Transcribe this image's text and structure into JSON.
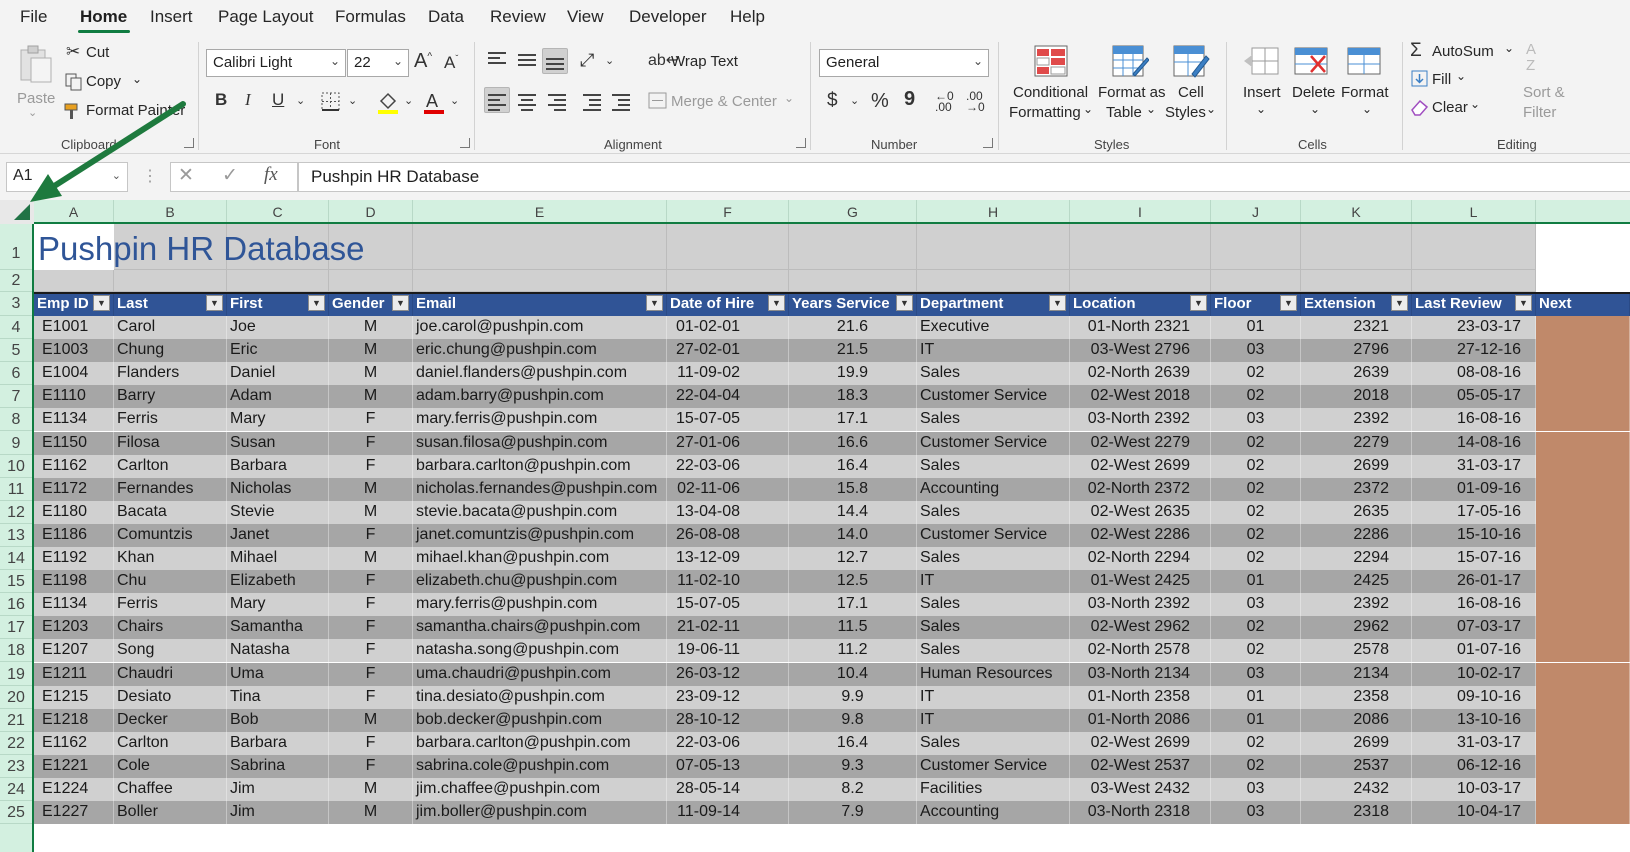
{
  "menu": {
    "items": [
      "File",
      "Home",
      "Insert",
      "Page Layout",
      "Formulas",
      "Data",
      "Review",
      "View",
      "Developer",
      "Help"
    ],
    "active": "Home",
    "accent": "#107c41"
  },
  "ribbon": {
    "clipboard": {
      "paste": "Paste",
      "cut": "Cut",
      "copy": "Copy",
      "format_painter": "Format Painter",
      "group": "Clipboard"
    },
    "font": {
      "family": "Calibri Light",
      "size": "22",
      "bold": "B",
      "italic": "I",
      "underline": "U",
      "grow": "A",
      "shrink": "A",
      "fill_color": "#ffff00",
      "font_color": "#e00000",
      "group": "Font"
    },
    "alignment": {
      "wrap_text": "Wrap Text",
      "merge_center": "Merge & Center",
      "group": "Alignment"
    },
    "number": {
      "format": "General",
      "currency": "$",
      "percent": "%",
      "comma": "9",
      "group": "Number"
    },
    "styles": {
      "conditional_1": "Conditional",
      "conditional_2": "Formatting",
      "format_table_1": "Format as",
      "format_table_2": "Table",
      "cell_styles_1": "Cell",
      "cell_styles_2": "Styles",
      "group": "Styles"
    },
    "cells": {
      "insert": "Insert",
      "delete": "Delete",
      "format": "Format",
      "group": "Cells"
    },
    "editing": {
      "autosum": "AutoSum",
      "fill": "Fill",
      "clear": "Clear",
      "sort_1": "Sort &",
      "sort_2": "Filter",
      "group": "Editing"
    }
  },
  "formula_bar": {
    "name_box": "A1",
    "fx": "fx",
    "content": "Pushpin HR Database"
  },
  "sheet": {
    "columns": [
      "A",
      "B",
      "C",
      "D",
      "E",
      "F",
      "G",
      "H",
      "I",
      "J",
      "K",
      "L"
    ],
    "rows": [
      "1",
      "2",
      "3",
      "4",
      "5",
      "6",
      "7",
      "8",
      "9",
      "10",
      "11",
      "12",
      "13",
      "14",
      "15",
      "16",
      "17",
      "18",
      "19",
      "20",
      "21",
      "22",
      "23",
      "24",
      "25"
    ],
    "title": "Pushpin HR Database",
    "headers": [
      "Emp ID",
      "Last",
      "First",
      "Gender",
      "Email",
      "Date of Hire",
      "Years Service",
      "Department",
      "Location",
      "Floor",
      "Extension",
      "Last Review",
      "Next"
    ],
    "header_color": "#305496",
    "band_dark": "#a6a6a6",
    "band_light": "#d0d0d0",
    "records": [
      [
        "E1001",
        "Carol",
        "Joe",
        "M",
        "joe.carol@pushpin.com",
        "01-02-01",
        "21.6",
        "Executive",
        "01-North 2321",
        "01",
        "2321",
        "23-03-17"
      ],
      [
        "E1003",
        "Chung",
        "Eric",
        "M",
        "eric.chung@pushpin.com",
        "27-02-01",
        "21.5",
        "IT",
        "03-West 2796",
        "03",
        "2796",
        "27-12-16"
      ],
      [
        "E1004",
        "Flanders",
        "Daniel",
        "M",
        "daniel.flanders@pushpin.com",
        "11-09-02",
        "19.9",
        "Sales",
        "02-North 2639",
        "02",
        "2639",
        "08-08-16"
      ],
      [
        "E1110",
        "Barry",
        "Adam",
        "M",
        "adam.barry@pushpin.com",
        "22-04-04",
        "18.3",
        "Customer Service",
        "02-West 2018",
        "02",
        "2018",
        "05-05-17"
      ],
      [
        "E1134",
        "Ferris",
        "Mary",
        "F",
        "mary.ferris@pushpin.com",
        "15-07-05",
        "17.1",
        "Sales",
        "03-North 2392",
        "03",
        "2392",
        "16-08-16"
      ],
      [
        "E1150",
        "Filosa",
        "Susan",
        "F",
        "susan.filosa@pushpin.com",
        "27-01-06",
        "16.6",
        "Customer Service",
        "02-West 2279",
        "02",
        "2279",
        "14-08-16"
      ],
      [
        "E1162",
        "Carlton",
        "Barbara",
        "F",
        "barbara.carlton@pushpin.com",
        "22-03-06",
        "16.4",
        "Sales",
        "02-West 2699",
        "02",
        "2699",
        "31-03-17"
      ],
      [
        "E1172",
        "Fernandes",
        "Nicholas",
        "M",
        "nicholas.fernandes@pushpin.com",
        "02-11-06",
        "15.8",
        "Accounting",
        "02-North 2372",
        "02",
        "2372",
        "01-09-16"
      ],
      [
        "E1180",
        "Bacata",
        "Stevie",
        "M",
        "stevie.bacata@pushpin.com",
        "13-04-08",
        "14.4",
        "Sales",
        "02-West 2635",
        "02",
        "2635",
        "17-05-16"
      ],
      [
        "E1186",
        "Comuntzis",
        "Janet",
        "F",
        "janet.comuntzis@pushpin.com",
        "26-08-08",
        "14.0",
        "Customer Service",
        "02-West 2286",
        "02",
        "2286",
        "15-10-16"
      ],
      [
        "E1192",
        "Khan",
        "Mihael",
        "M",
        "mihael.khan@pushpin.com",
        "13-12-09",
        "12.7",
        "Sales",
        "02-North 2294",
        "02",
        "2294",
        "15-07-16"
      ],
      [
        "E1198",
        "Chu",
        "Elizabeth",
        "F",
        "elizabeth.chu@pushpin.com",
        "11-02-10",
        "12.5",
        "IT",
        "01-West 2425",
        "01",
        "2425",
        "26-01-17"
      ],
      [
        "E1134",
        "Ferris",
        "Mary",
        "F",
        "mary.ferris@pushpin.com",
        "15-07-05",
        "17.1",
        "Sales",
        "03-North 2392",
        "03",
        "2392",
        "16-08-16"
      ],
      [
        "E1203",
        "Chairs",
        "Samantha",
        "F",
        "samantha.chairs@pushpin.com",
        "21-02-11",
        "11.5",
        "Sales",
        "02-West 2962",
        "02",
        "2962",
        "07-03-17"
      ],
      [
        "E1207",
        "Song",
        "Natasha",
        "F",
        "natasha.song@pushpin.com",
        "19-06-11",
        "11.2",
        "Sales",
        "02-North 2578",
        "02",
        "2578",
        "01-07-16"
      ],
      [
        "E1211",
        "Chaudri",
        "Uma",
        "F",
        "uma.chaudri@pushpin.com",
        "26-03-12",
        "10.4",
        "Human Resources",
        "03-North 2134",
        "03",
        "2134",
        "10-02-17"
      ],
      [
        "E1215",
        "Desiato",
        "Tina",
        "F",
        "tina.desiato@pushpin.com",
        "23-09-12",
        "9.9",
        "IT",
        "01-North 2358",
        "01",
        "2358",
        "09-10-16"
      ],
      [
        "E1218",
        "Decker",
        "Bob",
        "M",
        "bob.decker@pushpin.com",
        "28-10-12",
        "9.8",
        "IT",
        "01-North 2086",
        "01",
        "2086",
        "13-10-16"
      ],
      [
        "E1162",
        "Carlton",
        "Barbara",
        "F",
        "barbara.carlton@pushpin.com",
        "22-03-06",
        "16.4",
        "Sales",
        "02-West 2699",
        "02",
        "2699",
        "31-03-17"
      ],
      [
        "E1221",
        "Cole",
        "Sabrina",
        "F",
        "sabrina.cole@pushpin.com",
        "07-05-13",
        "9.3",
        "Customer Service",
        "02-West 2537",
        "02",
        "2537",
        "06-12-16"
      ],
      [
        "E1224",
        "Chaffee",
        "Jim",
        "M",
        "jim.chaffee@pushpin.com",
        "28-05-14",
        "8.2",
        "Facilities",
        "03-West 2432",
        "03",
        "2432",
        "10-03-17"
      ],
      [
        "E1227",
        "Boller",
        "Jim",
        "M",
        "jim.boller@pushpin.com",
        "11-09-14",
        "7.9",
        "Accounting",
        "03-North 2318",
        "03",
        "2318",
        "10-04-17"
      ]
    ],
    "next_col_color": "#c0896a"
  }
}
